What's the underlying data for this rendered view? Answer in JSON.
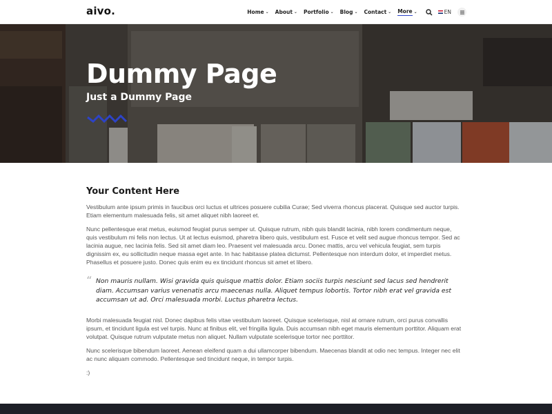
{
  "brand": {
    "logo": "aivo."
  },
  "nav": {
    "items": [
      {
        "label": "Home",
        "chevron": "⌄"
      },
      {
        "label": "About",
        "chevron": "⌄"
      },
      {
        "label": "Portfolio",
        "chevron": "⌄"
      },
      {
        "label": "Blog",
        "chevron": "⌄"
      },
      {
        "label": "Contact",
        "chevron": "⌄"
      },
      {
        "label": "More",
        "chevron": "⌄"
      }
    ],
    "language": "EN",
    "icons": [
      "search-icon",
      "flag-icon",
      "menu-icon"
    ]
  },
  "hero": {
    "title": "Dummy Page",
    "subtitle": "Just a Dummy Page",
    "accent_color": "#2d43c7"
  },
  "content": {
    "heading": "Your Content Here",
    "paragraphs": [
      "Vestibulum ante ipsum primis in faucibus orci luctus et ultrices posuere cubilia Curae; Sed viverra rhoncus placerat. Quisque sed auctor turpis. Etiam elementum malesuada felis, sit amet aliquet nibh laoreet et.",
      "Nunc pellentesque erat metus, euismod feugiat purus semper ut. Quisque rutrum, nibh quis blandit lacinia, nibh lorem condimentum neque, quis vestibulum mi felis non lectus. Ut at lectus euismod, pharetra libero quis, vestibulum est. Fusce et velit sed augue rhoncus tempor. Sed ac lacinia augue, nec lacinia felis. Sed sit amet diam leo. Praesent vel malesuada arcu. Donec mattis, arcu vel vehicula feugiat, sem turpis dignissim ex, eu sollicitudin neque massa eget ante. In hac habitasse platea dictumst. Pellentesque non interdum dolor, et imperdiet metus. Phasellus et posuere justo. Donec quis enim eu ex tincidunt rhoncus sit amet et libero.",
      "Morbi malesuada feugiat nisl. Donec dapibus felis vitae vestibulum laoreet. Quisque scelerisque, nisl at ornare rutrum, orci purus convallis ipsum, et tincidunt ligula est vel turpis. Nunc at finibus elit, vel fringilla ligula. Duis accumsan nibh eget mauris elementum porttitor. Aliquam erat volutpat. Quisque rutrum vulputate metus non aliquet. Nullam vulputate scelerisque tortor nec porttitor.",
      "Nunc scelerisque bibendum laoreet. Aenean eleifend quam a dui ullamcorper bibendum. Maecenas blandit at odio nec tempus. Integer nec elit ac nunc aliquam commodo. Pellentesque sed tincidunt neque, in tempor turpis.",
      ":)"
    ],
    "quote": "Non mauris nullam. Wisi gravida quis quisque mattis dolor. Etiam sociis turpis nesciunt sed lacus sed hendrerit diam. Accumsan varius venenatis arcu maecenas nulla. Aliquet tempus lobortis. Tortor nibh erat vel gravida est accumsan ut ad. Orci malesuada morbi. Luctus pharetra lectus.",
    "quote_mark": "“"
  },
  "colors": {
    "footer": "#1d1f27",
    "accent": "#2d43c7"
  }
}
